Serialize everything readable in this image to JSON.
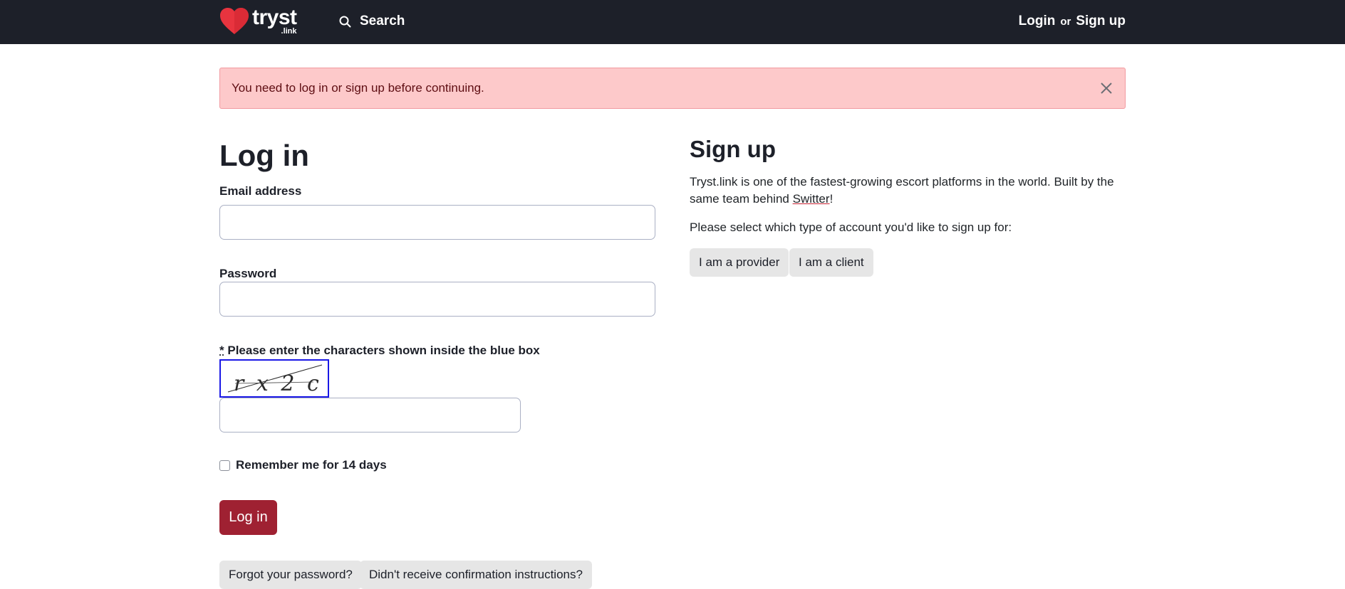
{
  "nav": {
    "brand_name": "tryst",
    "brand_sub": ".link",
    "search_label": "Search",
    "login_label": "Login",
    "or_label": "or",
    "signup_label": "Sign up"
  },
  "alert": {
    "message": "You need to log in or sign up before continuing."
  },
  "login": {
    "title": "Log in",
    "email_label": "Email address",
    "email_value": "",
    "password_label": "Password",
    "password_value": "",
    "captcha_required_mark": "*",
    "captcha_label": "Please enter the characters shown inside the blue box",
    "captcha_chars": "r x 2 c",
    "captcha_value": "",
    "remember_label": "Remember me for 14 days",
    "submit_label": "Log in",
    "forgot_label": "Forgot your password?",
    "confirm_label": "Didn't receive confirmation instructions?"
  },
  "signup": {
    "title": "Sign up",
    "intro_pre": "Tryst.link is one of the fastest-growing escort platforms in the world. Built by the same team behind ",
    "intro_link": "Switter",
    "intro_post": "!",
    "select_prompt": "Please select which type of account you'd like to sign up for:",
    "provider_label": "I am a provider",
    "client_label": "I am a client"
  },
  "colors": {
    "navbar_bg": "#1d2029",
    "brand_heart": "#e8343f",
    "alert_bg": "#fdc9ca",
    "primary_button": "#9f2132",
    "captcha_border": "#1a18e6"
  }
}
